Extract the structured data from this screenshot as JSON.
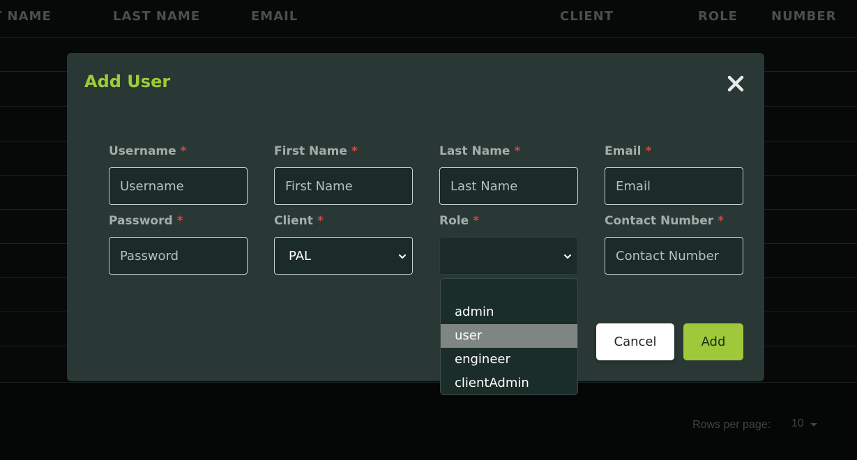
{
  "table": {
    "columns": [
      "T NAME",
      "LAST NAME",
      "EMAIL",
      "CLIENT",
      "ROLE",
      "NUMBER"
    ]
  },
  "pagination": {
    "rows_per_page_label": "Rows per page:",
    "rows_per_page_value": "10"
  },
  "modal": {
    "title": "Add User",
    "required_marker": "*",
    "fields": {
      "username": {
        "label": "Username",
        "placeholder": "Username"
      },
      "first_name": {
        "label": "First Name",
        "placeholder": "First Name"
      },
      "last_name": {
        "label": "Last Name",
        "placeholder": "Last Name"
      },
      "email": {
        "label": "Email",
        "placeholder": "Email"
      },
      "password": {
        "label": "Password",
        "placeholder": "Password"
      },
      "client": {
        "label": "Client",
        "value": "PAL"
      },
      "role": {
        "label": "Role",
        "value": ""
      },
      "contact_number": {
        "label": "Contact Number",
        "placeholder": "Contact Number"
      }
    },
    "role_options": [
      "",
      "admin",
      "user",
      "engineer",
      "clientAdmin"
    ],
    "role_highlighted": "user",
    "buttons": {
      "cancel": "Cancel",
      "add": "Add"
    }
  },
  "colors": {
    "accent": "#9ccc3a",
    "required": "#e0443e",
    "modal_bg": "#293834",
    "input_bg": "#1a2b28"
  }
}
